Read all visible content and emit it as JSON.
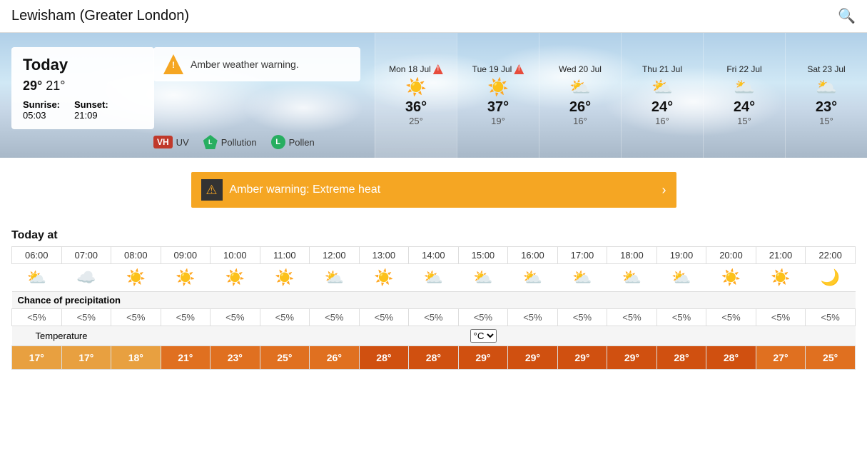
{
  "header": {
    "title": "Lewisham (Greater London)",
    "search_label": "search"
  },
  "today": {
    "label": "Today",
    "max_temp": "29°",
    "min_temp": "21°",
    "sunrise_label": "Sunrise:",
    "sunrise_time": "05:03",
    "sunset_label": "Sunset:",
    "sunset_time": "21:09",
    "warning_text": "Amber weather warning.",
    "uv_label": "UV",
    "uv_value": "VH",
    "pollution_label": "Pollution",
    "pollution_value": "L",
    "pollen_label": "Pollen",
    "pollen_value": "L"
  },
  "forecast": [
    {
      "day": "Mon 18 Jul",
      "alert": true,
      "icon": "☀️",
      "max": "36°",
      "min": "25°"
    },
    {
      "day": "Tue 19 Jul",
      "alert": true,
      "icon": "☀️",
      "max": "37°",
      "min": "19°"
    },
    {
      "day": "Wed 20 Jul",
      "alert": false,
      "icon": "⛅",
      "max": "26°",
      "min": "16°"
    },
    {
      "day": "Thu 21 Jul",
      "alert": false,
      "icon": "⛅",
      "max": "24°",
      "min": "16°"
    },
    {
      "day": "Fri 22 Jul",
      "alert": false,
      "icon": "🌥️",
      "max": "24°",
      "min": "15°"
    },
    {
      "day": "Sat 23 Jul",
      "alert": false,
      "icon": "🌥️",
      "max": "23°",
      "min": "15°"
    }
  ],
  "amber_warning": {
    "text": "Amber warning: Extreme heat"
  },
  "today_at": {
    "label": "Today at"
  },
  "hourly": {
    "times": [
      "06:00",
      "07:00",
      "08:00",
      "09:00",
      "10:00",
      "11:00",
      "12:00",
      "13:00",
      "14:00",
      "15:00",
      "16:00",
      "17:00",
      "18:00",
      "19:00",
      "20:00",
      "21:00",
      "22:00"
    ],
    "icons": [
      "⛅",
      "☁️",
      "☀️",
      "☀️",
      "☀️",
      "☀️",
      "⛅",
      "☀️",
      "⛅",
      "⛅",
      "⛅",
      "⛅",
      "⛅",
      "⛅",
      "☀️",
      "☀️",
      "🌙"
    ],
    "precip_label": "Chance of precipitation",
    "precip": [
      "<5%",
      "<5%",
      "<5%",
      "<5%",
      "<5%",
      "<5%",
      "<5%",
      "<5%",
      "<5%",
      "<5%",
      "<5%",
      "<5%",
      "<5%",
      "<5%",
      "<5%",
      "<5%",
      "<5%"
    ],
    "temp_label": "Temperature",
    "temp_unit": "°C",
    "temps": [
      "17°",
      "17°",
      "18°",
      "21°",
      "23°",
      "25°",
      "26°",
      "28°",
      "28°",
      "29°",
      "29°",
      "29°",
      "29°",
      "28°",
      "28°",
      "27°",
      "25°"
    ],
    "temp_colors": [
      "cool",
      "cool",
      "cool",
      "warm",
      "warm",
      "warm",
      "warm",
      "hot",
      "hot",
      "hot",
      "hot",
      "hot",
      "hot",
      "hot",
      "hot",
      "warm",
      "warm"
    ]
  }
}
